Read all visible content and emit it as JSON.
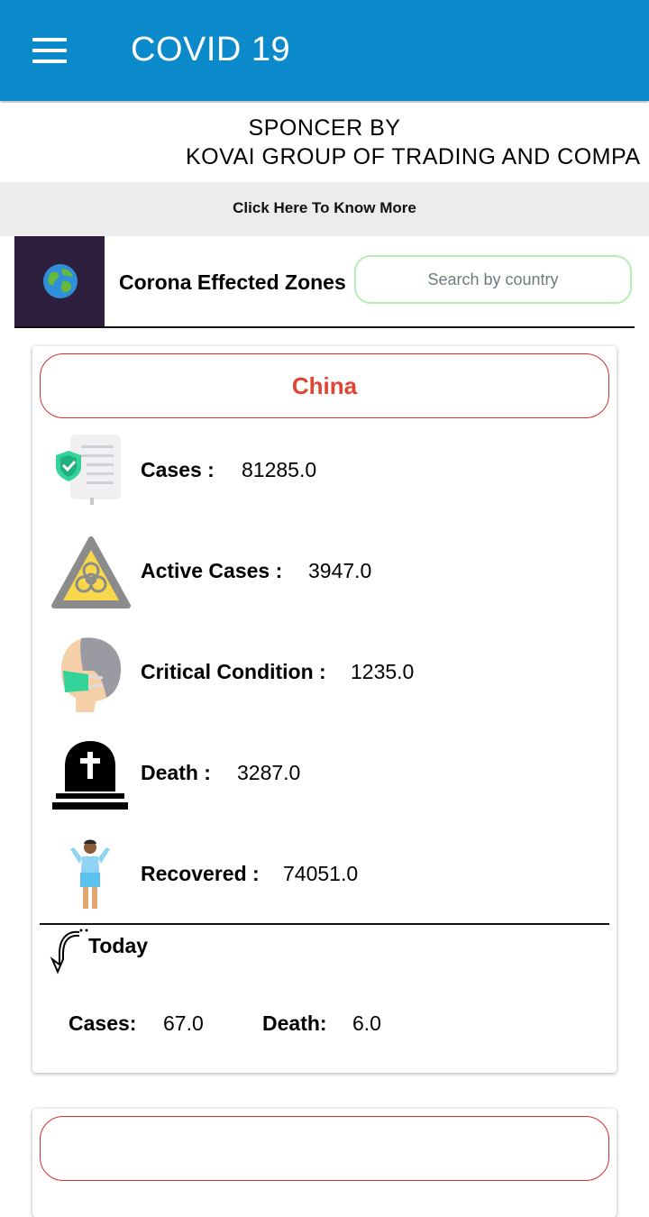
{
  "app": {
    "title": "COVID 19"
  },
  "sponsor": {
    "line1": "SPONCER BY",
    "line2": "KOVAI GROUP OF TRADING AND COMPA"
  },
  "banner": {
    "know_more": "Click Here To Know More"
  },
  "zones": {
    "title": "Corona Effected Zones",
    "search_placeholder": "Search by country"
  },
  "country": {
    "name": "China",
    "stats": [
      {
        "label": "Cases :",
        "value": "81285.0",
        "icon": "shield-document-icon"
      },
      {
        "label": "Active Cases :",
        "value": "3947.0",
        "icon": "biohazard-icon"
      },
      {
        "label": "Critical Condition :",
        "value": "1235.0",
        "icon": "masked-person-icon"
      },
      {
        "label": "Death :",
        "value": "3287.0",
        "icon": "tombstone-icon"
      },
      {
        "label": "Recovered :",
        "value": "74051.0",
        "icon": "recovered-person-icon"
      }
    ],
    "today": {
      "label": "Today",
      "cases_label": "Cases:",
      "cases_value": "67.0",
      "death_label": "Death:",
      "death_value": "6.0"
    }
  },
  "colors": {
    "appbar": "#0b8acb",
    "country_accent": "#e04432",
    "search_border": "#b5eeb2"
  }
}
